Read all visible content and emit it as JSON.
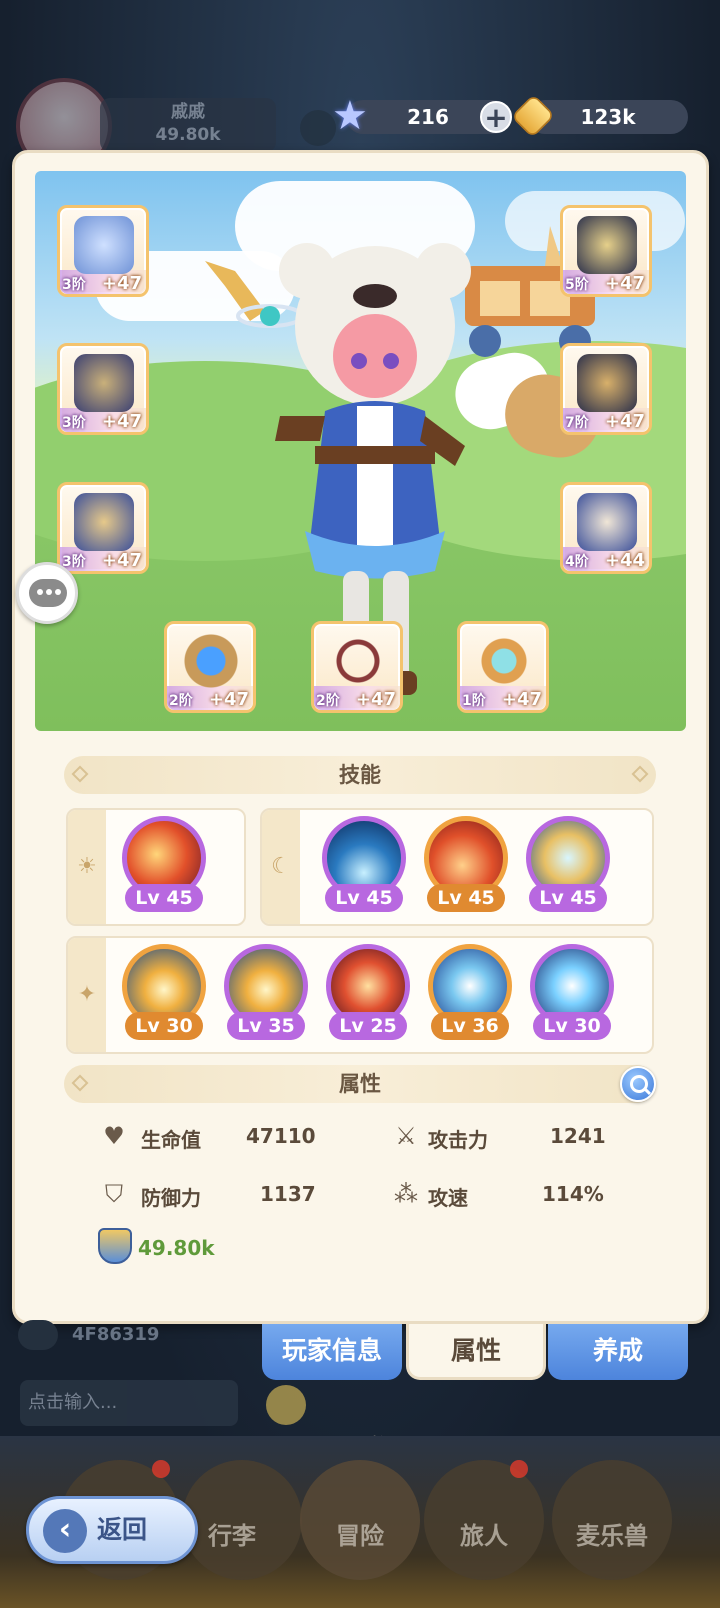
{
  "player": {
    "name": "戚戚",
    "power": "49.80k",
    "uid": "4F86319"
  },
  "resources": {
    "stars": "216",
    "coins": "123k"
  },
  "equipment": [
    {
      "slot": "helmet-left",
      "tier": "3阶",
      "level": "+47"
    },
    {
      "slot": "armor",
      "tier": "3阶",
      "level": "+47"
    },
    {
      "slot": "pants",
      "tier": "3阶",
      "level": "+47"
    },
    {
      "slot": "helmet-right",
      "tier": "5阶",
      "level": "+47"
    },
    {
      "slot": "gloves",
      "tier": "7阶",
      "level": "+47"
    },
    {
      "slot": "boots",
      "tier": "4阶",
      "level": "+44"
    },
    {
      "slot": "ring",
      "tier": "2阶",
      "level": "+47"
    },
    {
      "slot": "necklace",
      "tier": "2阶",
      "level": "+47"
    },
    {
      "slot": "amulet",
      "tier": "1阶",
      "level": "+47"
    }
  ],
  "skills_header": "技能",
  "skills": {
    "sun": [
      {
        "level": "Lv 45"
      }
    ],
    "moon": [
      {
        "level": "Lv 45"
      },
      {
        "level": "Lv 45"
      },
      {
        "level": "Lv 45"
      }
    ],
    "star": [
      {
        "level": "Lv 30"
      },
      {
        "level": "Lv 35"
      },
      {
        "level": "Lv 25"
      },
      {
        "level": "Lv 36"
      },
      {
        "level": "Lv 30"
      }
    ]
  },
  "attributes_header": "属性",
  "attributes": {
    "hp_label": "生命值",
    "hp": "47110",
    "atk_label": "攻击力",
    "atk": "1241",
    "def_label": "防御力",
    "def": "1137",
    "spd_label": "攻速",
    "spd": "114%",
    "power": "49.80k"
  },
  "tabs": {
    "player_info": "玩家信息",
    "attributes": "属性",
    "cultivate": "养成"
  },
  "chat": {
    "placeholder": "点击输入..."
  },
  "nav": {
    "bag": "行李",
    "adventure": "冒险",
    "traveler": "旅人",
    "mailebeast": "麦乐兽"
  },
  "back_label": "返回",
  "colors": {
    "purple_frame": "#b868e0",
    "orange_frame": "#e08a30",
    "tab_blue": "#4d84dc",
    "power_green": "#5f9a3a"
  }
}
